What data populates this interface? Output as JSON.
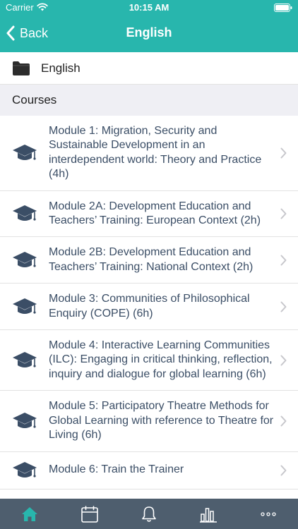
{
  "status_bar": {
    "carrier": "Carrier",
    "time": "10:15 AM"
  },
  "nav": {
    "back_label": "Back",
    "title": "English"
  },
  "folder": {
    "label": "English",
    "icon": "folder-icon"
  },
  "section": {
    "label": "Courses"
  },
  "courses": [
    {
      "title": "Module 1: Migration, Security and Sustainable Development in an interdependent world: Theory and Practice (4h)"
    },
    {
      "title": "Module 2A: Development Education and Teachers’ Training: European Context (2h)"
    },
    {
      "title": "Module 2B: Development Education and Teachers’ Training: National Context (2h)"
    },
    {
      "title": "Module 3: Communities of Philosophical Enquiry (COPE) (6h)"
    },
    {
      "title": "Module 4: Interactive Learning Communities (ILC): Engaging in critical thinking, reflection, inquiry and dialogue for global learning (6h)"
    },
    {
      "title": "Module 5: Participatory Theatre Methods for Global Learning with reference to Theatre for Living (6h)"
    },
    {
      "title": "Module 6: Train the Trainer"
    }
  ],
  "tabs": [
    {
      "name": "home-icon",
      "active": true
    },
    {
      "name": "calendar-icon",
      "active": false
    },
    {
      "name": "bell-icon",
      "active": false
    },
    {
      "name": "bar-chart-icon",
      "active": false
    },
    {
      "name": "more-icon",
      "active": false
    }
  ],
  "colors": {
    "accent": "#28b6ad",
    "tab_bar": "#4e5e6e",
    "text": "#3b4e66",
    "section_bg": "#efeff4"
  }
}
